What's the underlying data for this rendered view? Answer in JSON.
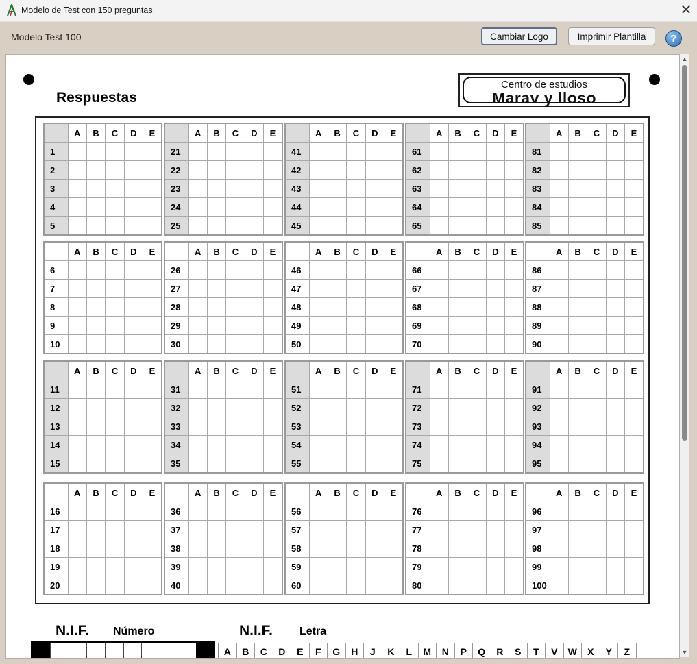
{
  "window": {
    "title": "Modelo de Test con 150 preguntas",
    "close_glyph": "✕"
  },
  "toolbar": {
    "model_label": "Modelo Test 100",
    "change_logo": "Cambiar Logo",
    "print_template": "Imprimir Plantilla",
    "help_glyph": "?"
  },
  "sheet": {
    "title": "Respuestas",
    "logo": {
      "line1": "Centro de estudios",
      "line2": "Marav y lloso"
    },
    "options": [
      "A",
      "B",
      "C",
      "D",
      "E"
    ],
    "blocks": [
      [
        [
          1,
          2,
          3,
          4,
          5
        ],
        [
          21,
          22,
          23,
          24,
          25
        ],
        [
          41,
          42,
          43,
          44,
          45
        ],
        [
          61,
          62,
          63,
          64,
          65
        ],
        [
          81,
          82,
          83,
          84,
          85
        ]
      ],
      [
        [
          6,
          7,
          8,
          9,
          10
        ],
        [
          26,
          27,
          28,
          29,
          30
        ],
        [
          46,
          47,
          48,
          49,
          50
        ],
        [
          66,
          67,
          68,
          69,
          70
        ],
        [
          86,
          87,
          88,
          89,
          90
        ]
      ],
      [
        [
          11,
          12,
          13,
          14,
          15
        ],
        [
          31,
          32,
          33,
          34,
          35
        ],
        [
          51,
          52,
          53,
          54,
          55
        ],
        [
          71,
          72,
          73,
          74,
          75
        ],
        [
          91,
          92,
          93,
          94,
          95
        ]
      ],
      [
        [
          16,
          17,
          18,
          19,
          20
        ],
        [
          36,
          37,
          38,
          39,
          40
        ],
        [
          56,
          57,
          58,
          59,
          60
        ],
        [
          76,
          77,
          78,
          79,
          80
        ],
        [
          96,
          97,
          98,
          99,
          100
        ]
      ]
    ],
    "nif": {
      "label_numero": "N.I.F.",
      "sub_numero": "Número",
      "label_letra": "N.I.F.",
      "sub_letra": "Letra",
      "letters": [
        "A",
        "B",
        "C",
        "D",
        "E",
        "F",
        "G",
        "H",
        "J",
        "K",
        "L",
        "M",
        "N",
        "P",
        "Q",
        "R",
        "S",
        "T",
        "V",
        "W",
        "X",
        "Y",
        "Z"
      ]
    }
  },
  "scroll": {
    "up": "▲",
    "down": "▼"
  }
}
